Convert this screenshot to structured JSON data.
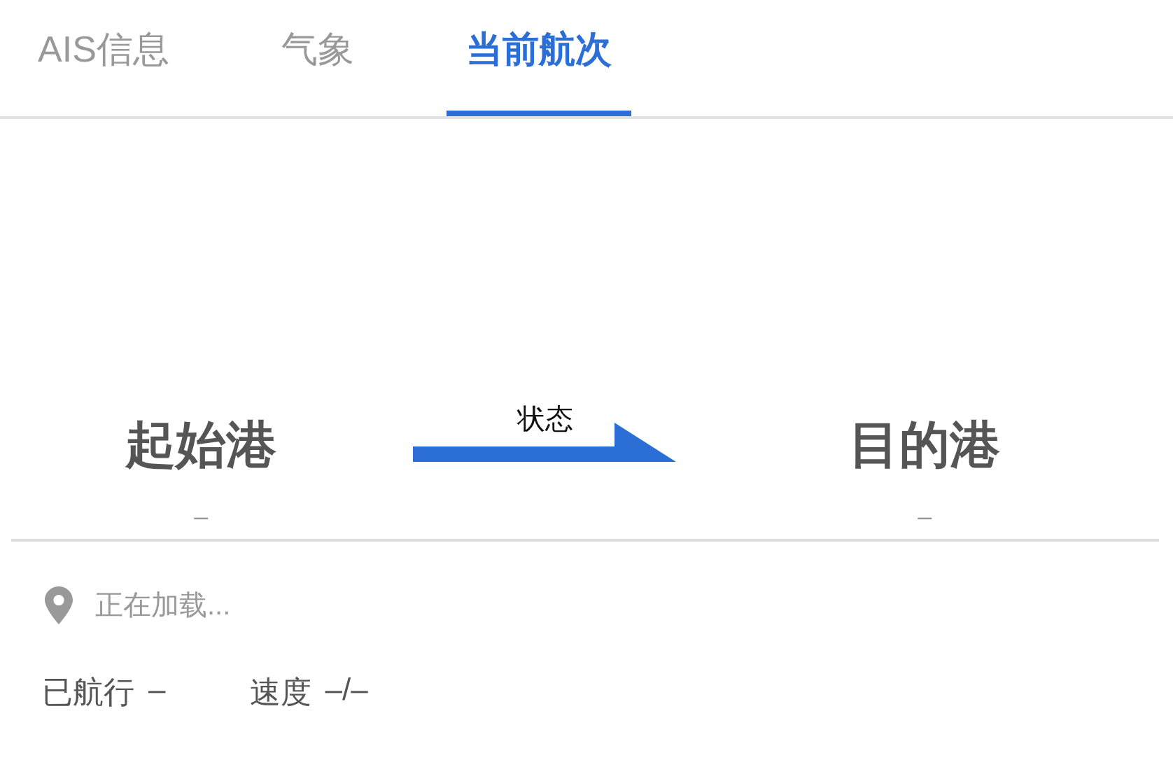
{
  "tabs": [
    {
      "label": "AIS信息",
      "selected": false
    },
    {
      "label": "气象",
      "selected": false
    },
    {
      "label": "当前航次",
      "selected": true
    }
  ],
  "route": {
    "origin": {
      "name": "起始港",
      "value": "–"
    },
    "status": "状态",
    "destination": {
      "name": "目的港",
      "value": "–"
    }
  },
  "location": {
    "text": "正在加载..."
  },
  "stats": [
    {
      "label": "已航行",
      "value": "–"
    },
    {
      "label": "速度",
      "value": "–/–"
    }
  ]
}
